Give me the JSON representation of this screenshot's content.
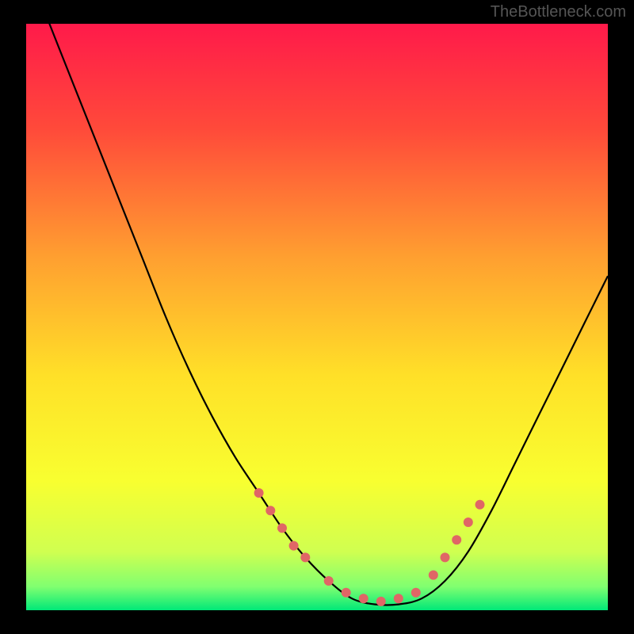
{
  "watermark": "TheBottleneck.com",
  "chart_data": {
    "type": "line",
    "title": "",
    "xlabel": "",
    "ylabel": "",
    "xlim": [
      0,
      100
    ],
    "ylim": [
      0,
      100
    ],
    "gradient_stops": [
      {
        "offset": 0,
        "color": "#ff1a4a"
      },
      {
        "offset": 18,
        "color": "#ff4a3a"
      },
      {
        "offset": 40,
        "color": "#ffa030"
      },
      {
        "offset": 60,
        "color": "#ffe028"
      },
      {
        "offset": 78,
        "color": "#f8ff30"
      },
      {
        "offset": 90,
        "color": "#d0ff50"
      },
      {
        "offset": 96,
        "color": "#80ff70"
      },
      {
        "offset": 100,
        "color": "#00e878"
      }
    ],
    "series": [
      {
        "name": "bottleneck-curve",
        "x": [
          0,
          4,
          8,
          12,
          16,
          20,
          24,
          28,
          32,
          36,
          40,
          44,
          48,
          52,
          56,
          60,
          64,
          68,
          72,
          76,
          80,
          84,
          88,
          92,
          96,
          100
        ],
        "y": [
          110,
          100,
          90,
          80,
          70,
          60,
          50,
          41,
          33,
          26,
          20,
          14,
          9,
          5,
          2,
          1,
          1,
          2,
          5,
          10,
          17,
          25,
          33,
          41,
          49,
          57
        ]
      }
    ],
    "markers": {
      "name": "highlight-points",
      "color": "#e06666",
      "radius": 6,
      "points": [
        {
          "x": 40,
          "y": 20
        },
        {
          "x": 42,
          "y": 17
        },
        {
          "x": 44,
          "y": 14
        },
        {
          "x": 46,
          "y": 11
        },
        {
          "x": 48,
          "y": 9
        },
        {
          "x": 52,
          "y": 5
        },
        {
          "x": 55,
          "y": 3
        },
        {
          "x": 58,
          "y": 2
        },
        {
          "x": 61,
          "y": 1.5
        },
        {
          "x": 64,
          "y": 2
        },
        {
          "x": 67,
          "y": 3
        },
        {
          "x": 70,
          "y": 6
        },
        {
          "x": 72,
          "y": 9
        },
        {
          "x": 74,
          "y": 12
        },
        {
          "x": 76,
          "y": 15
        },
        {
          "x": 78,
          "y": 18
        }
      ]
    }
  }
}
